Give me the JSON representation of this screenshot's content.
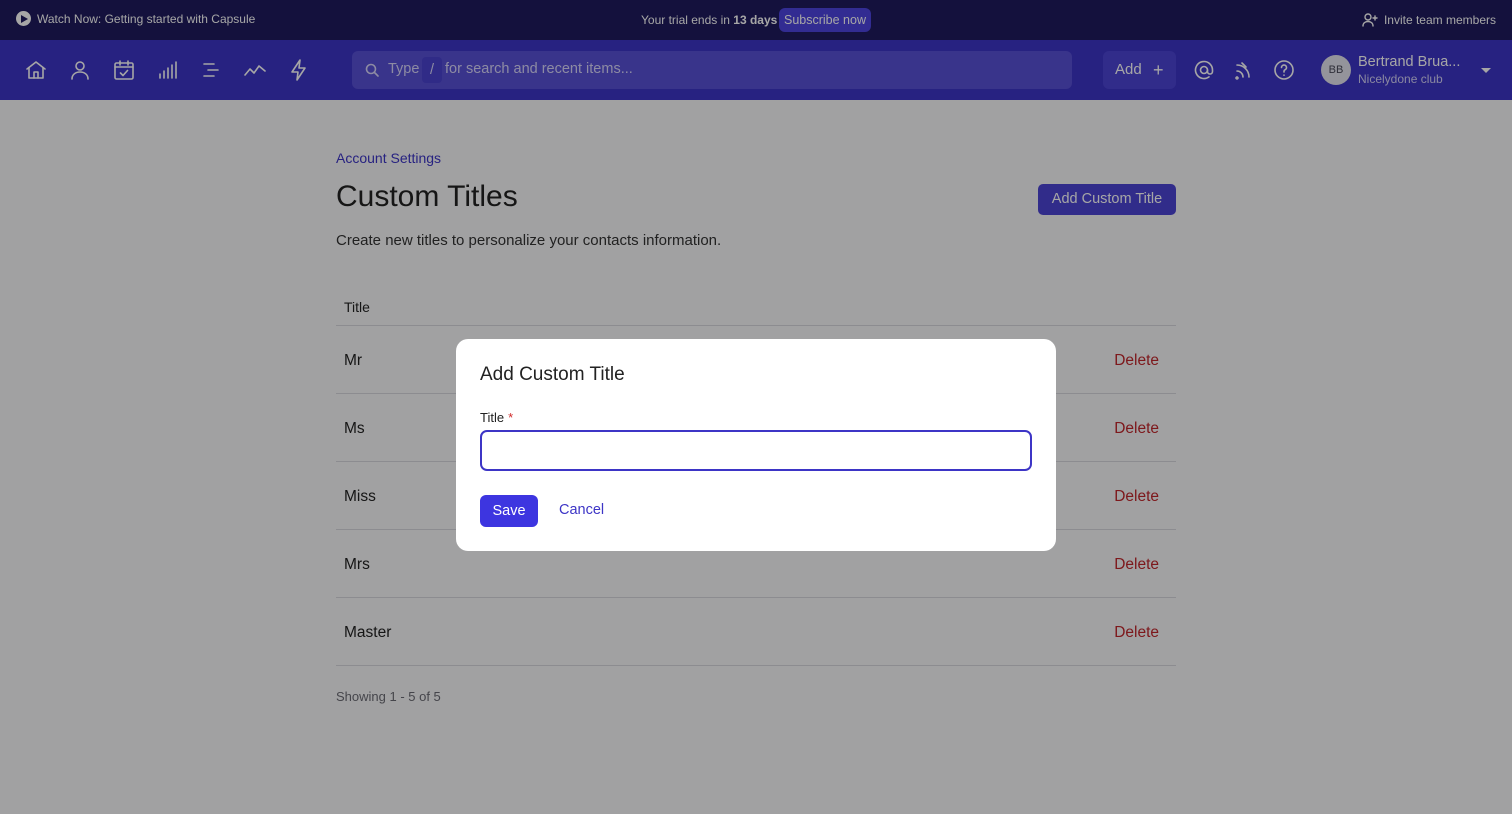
{
  "topbar": {
    "watch_label": "Watch Now: Getting started with Capsule",
    "trial_prefix": "Your trial ends in",
    "trial_days": "13 days",
    "subscribe_label": "Subscribe now",
    "invite_label": "Invite team members"
  },
  "nav": {
    "icons": [
      "home-icon",
      "person-icon",
      "calendar-check-icon",
      "bar-chart-icon",
      "list-icon",
      "trend-line-icon",
      "lightning-icon"
    ],
    "search_type_label": "Type",
    "search_slash": "/",
    "search_placeholder": "for search and recent items...",
    "add_label": "Add",
    "add_plus": "+",
    "user_initials": "BB",
    "user_name": "Bertrand Brua...",
    "user_org": "Nicelydone club"
  },
  "page": {
    "breadcrumb": "Account Settings",
    "title": "Custom Titles",
    "description": "Create new titles to personalize your contacts information.",
    "add_button": "Add Custom Title",
    "table_header": "Title",
    "rows": [
      {
        "name": "Mr",
        "action": "Delete"
      },
      {
        "name": "Ms",
        "action": "Delete"
      },
      {
        "name": "Miss",
        "action": "Delete"
      },
      {
        "name": "Mrs",
        "action": "Delete"
      },
      {
        "name": "Master",
        "action": "Delete"
      }
    ],
    "pagination": "Showing 1 - 5 of 5"
  },
  "modal": {
    "title": "Add Custom Title",
    "field_label": "Title",
    "required_mark": "*",
    "field_value": "",
    "save_label": "Save",
    "cancel_label": "Cancel"
  },
  "colors": {
    "topbar_bg": "#1f1b5e",
    "navbar_bg": "#3d35c6",
    "accent": "#3d35e0",
    "delete_red": "#c1262b"
  }
}
